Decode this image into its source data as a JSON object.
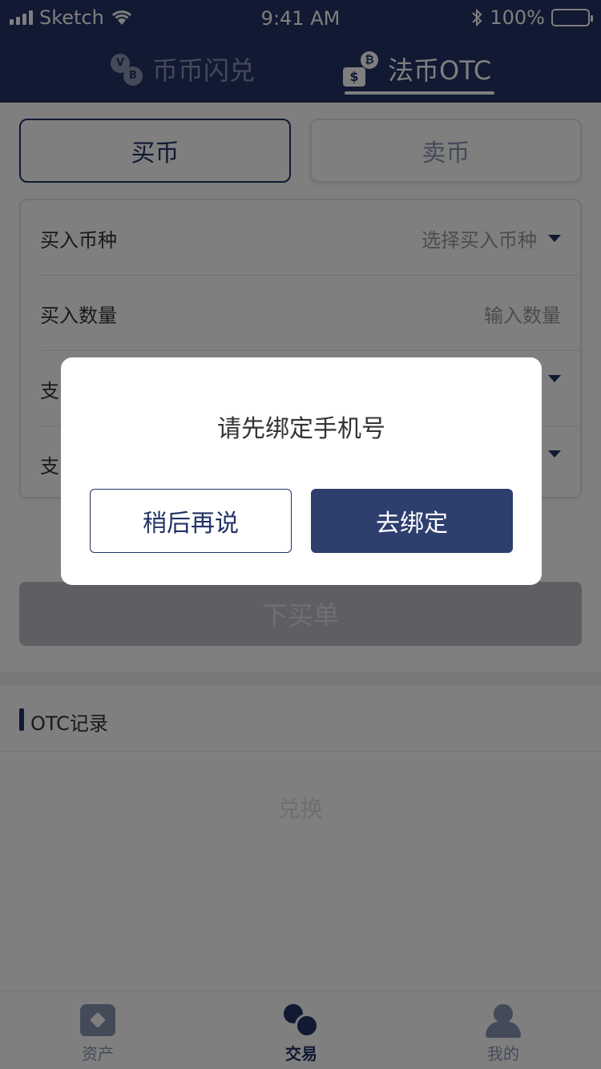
{
  "status_bar": {
    "carrier": "Sketch",
    "time": "9:41 AM",
    "battery": "100%"
  },
  "top_tabs": [
    {
      "label": "币币闪兑",
      "active": false
    },
    {
      "label": "法币OTC",
      "active": true
    }
  ],
  "segment": {
    "buy_label": "买币",
    "sell_label": "卖币",
    "selected": "买币"
  },
  "form": {
    "rows": [
      {
        "label": "买入币种",
        "value": "选择买入币种",
        "dropdown": true
      },
      {
        "label": "买入数量",
        "value": "输入数量",
        "dropdown": false
      },
      {
        "label": "支",
        "value": "",
        "dropdown": true
      },
      {
        "label": "支",
        "value": "",
        "dropdown": true
      }
    ]
  },
  "submit_label": "下买单",
  "records": {
    "title": "OTC记录",
    "empty_text": "兑换"
  },
  "tabbar": [
    {
      "label": "资产",
      "icon": "assets-icon",
      "active": false
    },
    {
      "label": "交易",
      "icon": "trade-icon",
      "active": true
    },
    {
      "label": "我的",
      "icon": "profile-icon",
      "active": false
    }
  ],
  "modal": {
    "message": "请先绑定手机号",
    "later_label": "稍后再说",
    "bind_label": "去绑定"
  },
  "colors": {
    "primary": "#233366",
    "muted": "#8a94b3",
    "modal_button": "#2e3f6e"
  }
}
